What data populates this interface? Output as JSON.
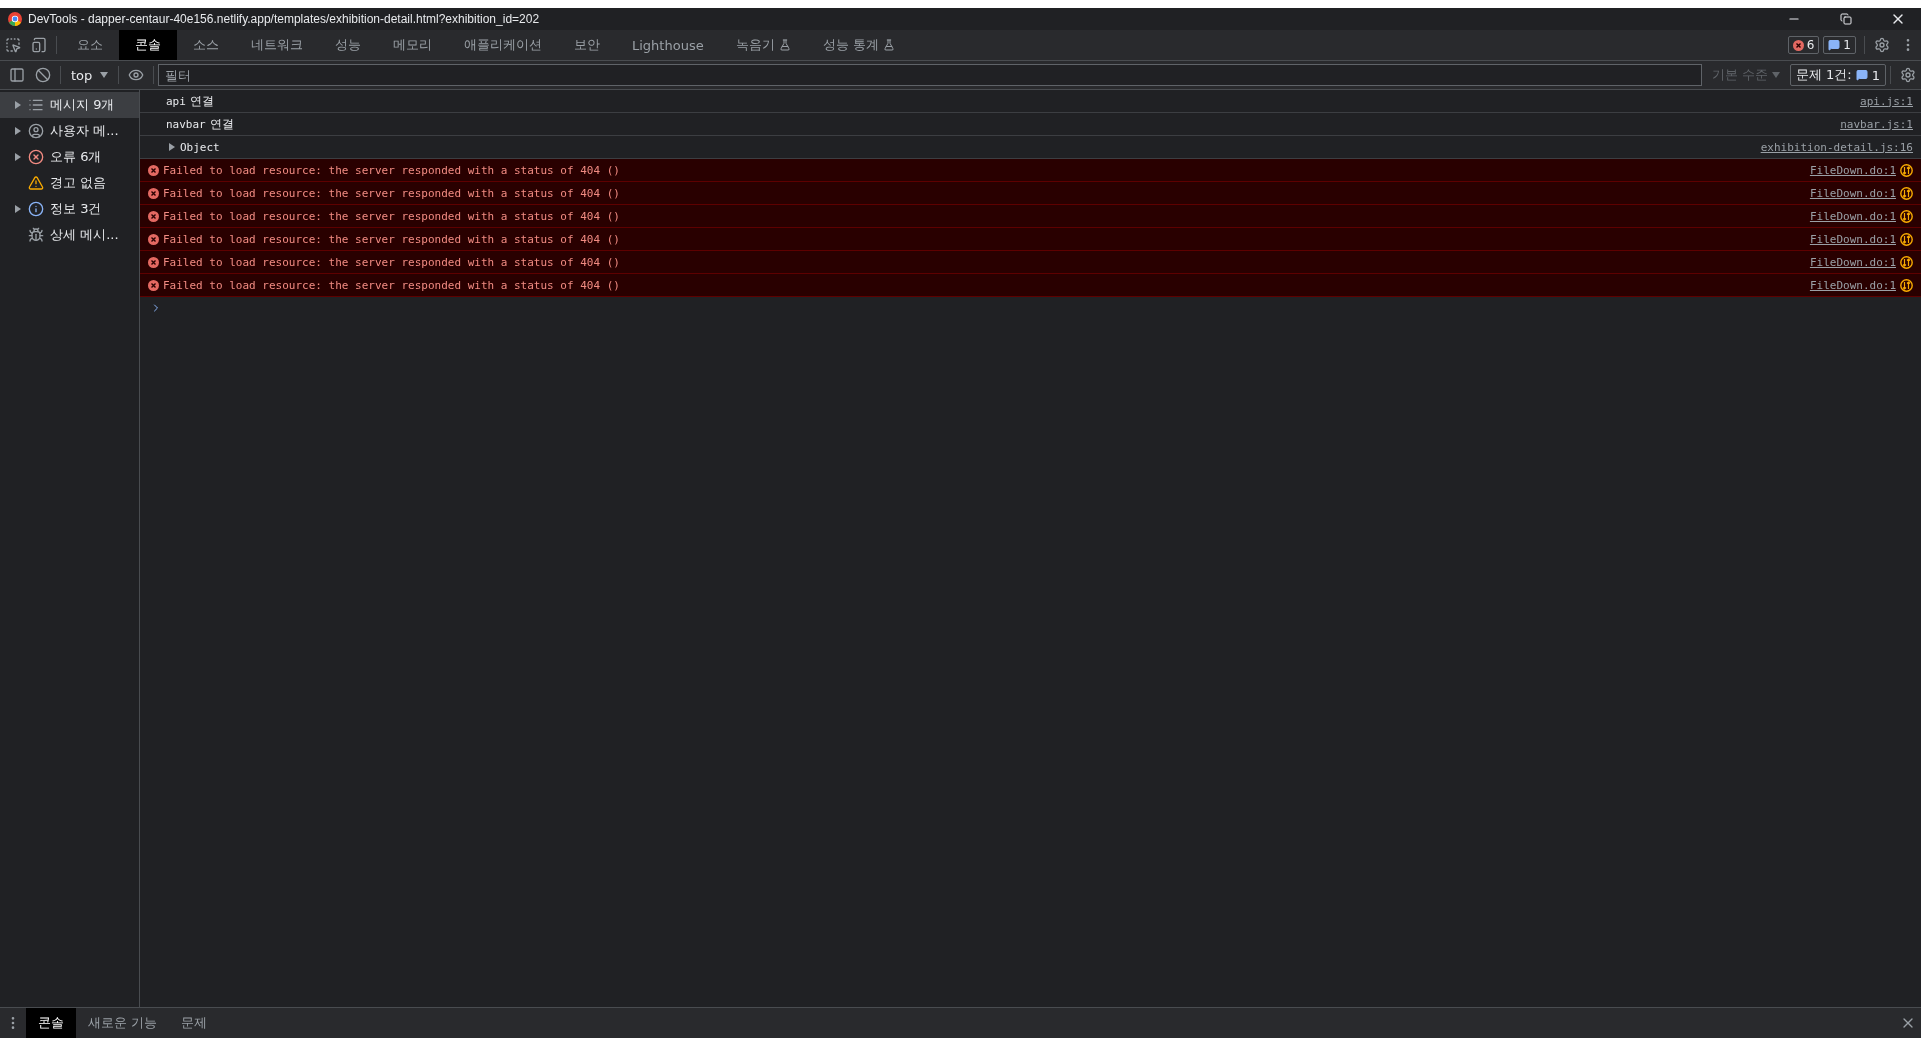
{
  "window": {
    "title": "DevTools - dapper-centaur-40e156.netlify.app/templates/exhibition-detail.html?exhibition_id=202"
  },
  "tabs": [
    {
      "label": "요소",
      "selected": false,
      "experimental": false
    },
    {
      "label": "콘솔",
      "selected": true,
      "experimental": false
    },
    {
      "label": "소스",
      "selected": false,
      "experimental": false
    },
    {
      "label": "네트워크",
      "selected": false,
      "experimental": false
    },
    {
      "label": "성능",
      "selected": false,
      "experimental": false
    },
    {
      "label": "메모리",
      "selected": false,
      "experimental": false
    },
    {
      "label": "애플리케이션",
      "selected": false,
      "experimental": false
    },
    {
      "label": "보안",
      "selected": false,
      "experimental": false
    },
    {
      "label": "Lighthouse",
      "selected": false,
      "experimental": false
    },
    {
      "label": "녹음기",
      "selected": false,
      "experimental": true
    },
    {
      "label": "성능 통계",
      "selected": false,
      "experimental": true
    }
  ],
  "counters": {
    "errors": "6",
    "messages": "1"
  },
  "toolbar": {
    "context": "top",
    "filter": {
      "placeholder": "필터"
    },
    "levels": "기본 수준",
    "issues_label": "문제 1건:",
    "issues_count": "1"
  },
  "sidebar": {
    "items": [
      {
        "label": "메시지 9개",
        "kind": "list",
        "expandable": true,
        "selected": true
      },
      {
        "label": "사용자 메...",
        "kind": "user",
        "expandable": true,
        "selected": false
      },
      {
        "label": "오류 6개",
        "kind": "error",
        "expandable": true,
        "selected": false
      },
      {
        "label": "경고 없음",
        "kind": "warning",
        "expandable": false,
        "selected": false
      },
      {
        "label": "정보 3건",
        "kind": "info",
        "expandable": true,
        "selected": false
      },
      {
        "label": "상세 메시...",
        "kind": "verbose",
        "expandable": false,
        "selected": false
      }
    ]
  },
  "messages": [
    {
      "kind": "log",
      "code": "api",
      "text": "연결",
      "source": "api.js:1"
    },
    {
      "kind": "log",
      "code": "navbar",
      "text": "연결",
      "source": "navbar.js:1"
    },
    {
      "kind": "object",
      "code": "Object",
      "expanded": false,
      "source": "exhibition-detail.js:16"
    },
    {
      "kind": "error",
      "code": "Failed to load resource: the server responded with a status of 404 ()",
      "source": "FileDown.do:1"
    },
    {
      "kind": "error",
      "code": "Failed to load resource: the server responded with a status of 404 ()",
      "source": "FileDown.do:1"
    },
    {
      "kind": "error",
      "code": "Failed to load resource: the server responded with a status of 404 ()",
      "source": "FileDown.do:1"
    },
    {
      "kind": "error",
      "code": "Failed to load resource: the server responded with a status of 404 ()",
      "source": "FileDown.do:1"
    },
    {
      "kind": "error",
      "code": "Failed to load resource: the server responded with a status of 404 ()",
      "source": "FileDown.do:1"
    },
    {
      "kind": "error",
      "code": "Failed to load resource: the server responded with a status of 404 ()",
      "source": "FileDown.do:1"
    }
  ],
  "drawer": {
    "tabs": [
      {
        "label": "콘솔",
        "selected": true
      },
      {
        "label": "새로운 기능",
        "selected": false
      },
      {
        "label": "문제",
        "selected": false
      }
    ]
  }
}
